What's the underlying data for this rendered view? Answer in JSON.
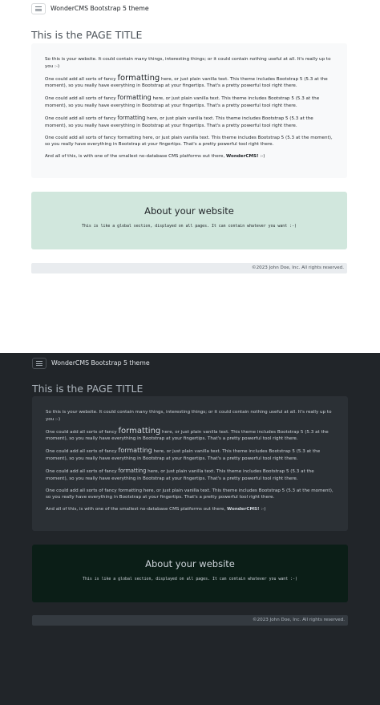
{
  "navbar": {
    "brand": "WonderCMS Bootstrap 5 theme",
    "toggler_icon": "hamburger-menu-icon"
  },
  "page": {
    "title": "This is the PAGE TITLE"
  },
  "content": {
    "p1": "So this is your website. It could contain many things, interesting things; or it could contain nothing useful at all. It's really up to you :-)",
    "para_prefix": "One could add all sorts of fancy ",
    "formatting_word": "formatting",
    "para_suffix": " here, or just plain vanilla text. This theme includes Bootstrap 5 (5.3 at the moment), so you really have everything in Bootstrap at your fingertips. That's a pretty powerful tool right there.",
    "last_prefix": "And all of this, is with one of the smallest no-database CMS platforms out there, ",
    "last_bold": "WonderCMS!",
    "last_suffix": " :-)"
  },
  "about": {
    "title": "About your website",
    "text": "This is like a global section, displayed on all pages. It can contain whatever you want :-)"
  },
  "footer": {
    "text": "©2023 John Doe, Inc. All rights reserved."
  },
  "colors": {
    "light_background": "#ffffff",
    "dark_background": "#212529",
    "about_light": "#d1e7dd",
    "about_dark": "#0b1e17"
  }
}
